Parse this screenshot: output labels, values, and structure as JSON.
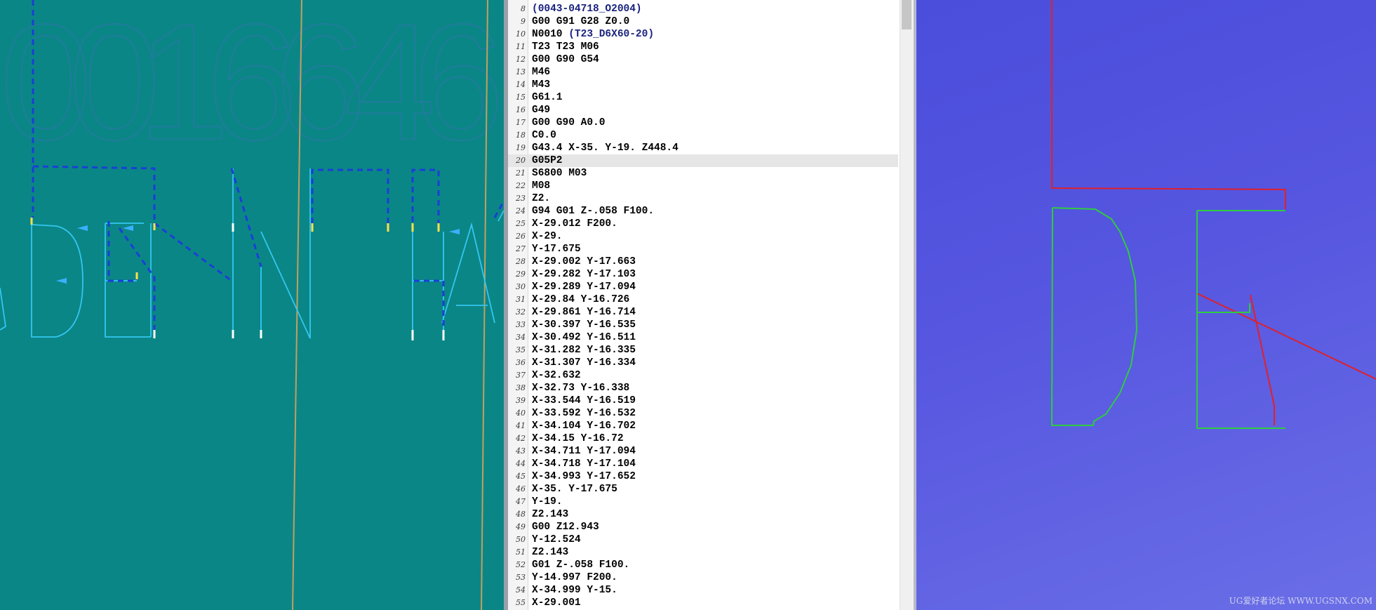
{
  "left_view": {
    "background_color": "#0b8686",
    "background_digits": [
      "0",
      "0",
      "1",
      "6",
      "6",
      "4",
      "6"
    ]
  },
  "editor": {
    "current_line": 20,
    "lines": [
      {
        "n": "8",
        "code": "",
        "comment": "(0043-04718_O2004)"
      },
      {
        "n": "9",
        "code": "G00 G91 G28 Z0.0",
        "comment": ""
      },
      {
        "n": "10",
        "code": "N0010 ",
        "comment": "(T23_D6X60-20)"
      },
      {
        "n": "11",
        "code": "T23 T23 M06",
        "comment": ""
      },
      {
        "n": "12",
        "code": "G00 G90 G54",
        "comment": ""
      },
      {
        "n": "13",
        "code": "M46",
        "comment": ""
      },
      {
        "n": "14",
        "code": "M43",
        "comment": ""
      },
      {
        "n": "15",
        "code": "G61.1",
        "comment": ""
      },
      {
        "n": "16",
        "code": "G49",
        "comment": ""
      },
      {
        "n": "17",
        "code": "G00 G90 A0.0",
        "comment": ""
      },
      {
        "n": "18",
        "code": "C0.0",
        "comment": ""
      },
      {
        "n": "19",
        "code": "G43.4 X-35. Y-19. Z448.4",
        "comment": ""
      },
      {
        "n": "20",
        "code": "G05P2",
        "comment": ""
      },
      {
        "n": "21",
        "code": "S6800 M03",
        "comment": ""
      },
      {
        "n": "22",
        "code": "M08",
        "comment": ""
      },
      {
        "n": "23",
        "code": "Z2.",
        "comment": ""
      },
      {
        "n": "24",
        "code": "G94 G01 Z-.058 F100.",
        "comment": ""
      },
      {
        "n": "25",
        "code": "X-29.012 F200.",
        "comment": ""
      },
      {
        "n": "26",
        "code": "X-29.",
        "comment": ""
      },
      {
        "n": "27",
        "code": "Y-17.675",
        "comment": ""
      },
      {
        "n": "28",
        "code": "X-29.002 Y-17.663",
        "comment": ""
      },
      {
        "n": "29",
        "code": "X-29.282 Y-17.103",
        "comment": ""
      },
      {
        "n": "30",
        "code": "X-29.289 Y-17.094",
        "comment": ""
      },
      {
        "n": "31",
        "code": "X-29.84 Y-16.726",
        "comment": ""
      },
      {
        "n": "32",
        "code": "X-29.861 Y-16.714",
        "comment": ""
      },
      {
        "n": "33",
        "code": "X-30.397 Y-16.535",
        "comment": ""
      },
      {
        "n": "34",
        "code": "X-30.492 Y-16.511",
        "comment": ""
      },
      {
        "n": "35",
        "code": "X-31.282 Y-16.335",
        "comment": ""
      },
      {
        "n": "36",
        "code": "X-31.307 Y-16.334",
        "comment": ""
      },
      {
        "n": "37",
        "code": "X-32.632",
        "comment": ""
      },
      {
        "n": "38",
        "code": "X-32.73 Y-16.338",
        "comment": ""
      },
      {
        "n": "39",
        "code": "X-33.544 Y-16.519",
        "comment": ""
      },
      {
        "n": "40",
        "code": "X-33.592 Y-16.532",
        "comment": ""
      },
      {
        "n": "41",
        "code": "X-34.104 Y-16.702",
        "comment": ""
      },
      {
        "n": "42",
        "code": "X-34.15 Y-16.72",
        "comment": ""
      },
      {
        "n": "43",
        "code": "X-34.711 Y-17.094",
        "comment": ""
      },
      {
        "n": "44",
        "code": "X-34.718 Y-17.104",
        "comment": ""
      },
      {
        "n": "45",
        "code": "X-34.993 Y-17.652",
        "comment": ""
      },
      {
        "n": "46",
        "code": "X-35. Y-17.675",
        "comment": ""
      },
      {
        "n": "47",
        "code": "Y-19.",
        "comment": ""
      },
      {
        "n": "48",
        "code": "Z2.143",
        "comment": ""
      },
      {
        "n": "49",
        "code": "G00 Z12.943",
        "comment": ""
      },
      {
        "n": "50",
        "code": "Y-12.524",
        "comment": ""
      },
      {
        "n": "51",
        "code": "Z2.143",
        "comment": ""
      },
      {
        "n": "52",
        "code": "G01 Z-.058 F100.",
        "comment": ""
      },
      {
        "n": "53",
        "code": "Y-14.997 F200.",
        "comment": ""
      },
      {
        "n": "54",
        "code": "X-34.999 Y-15.",
        "comment": ""
      },
      {
        "n": "55",
        "code": "X-29.001",
        "comment": ""
      }
    ]
  },
  "right_view": {
    "rapid_color": "#e0202a",
    "feed_color": "#2ecc40"
  },
  "watermark": "UG爱好者论坛 WWW.UGSNX.COM"
}
